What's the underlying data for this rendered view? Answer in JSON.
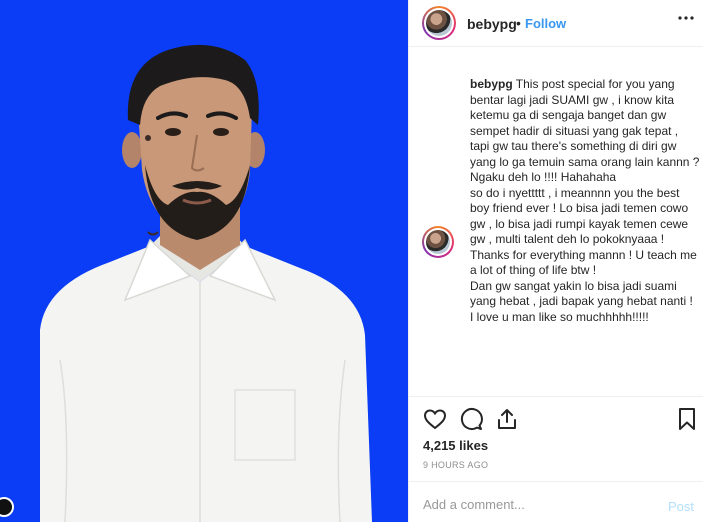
{
  "post": {
    "username": "bebypg",
    "separator": "•",
    "follow_label": "Follow",
    "more_icon": "more-icon"
  },
  "caption": {
    "username": "bebypg",
    "text": " This post special for you yang bentar lagi jadi SUAMI gw , i know kita ketemu ga di sengaja banget dan gw sempet hadir di situasi yang gak tepat , tapi gw tau there's something di diri gw yang lo ga temuin sama orang lain kannn ? Ngaku deh lo !!!! Hahahaha\nso do i nyettttt , i meannnn you the best boy friend ever ! Lo bisa jadi temen cowo gw , lo bisa jadi rumpi kayak temen cewe gw , multi talent deh lo pokoknyaaa !\nThanks for everything mannn ! U teach me a lot of thing of life btw !\nDan gw sangat yakin lo bisa jadi suami yang hebat , jadi bapak yang hebat nanti !\nI love u man like so muchhhhh!!!!!"
  },
  "actions": {
    "like_icon": "heart-icon",
    "comment_icon": "comment-icon",
    "share_icon": "share-icon",
    "save_icon": "bookmark-icon"
  },
  "likes": "4,215 likes",
  "timestamp": "9 HOURS AGO",
  "comment": {
    "placeholder": "Add a comment...",
    "post_label": "Post"
  },
  "colors": {
    "photo_background": "#0a3df5",
    "link_blue": "#3897f0",
    "post_disabled": "#b2dffc"
  }
}
